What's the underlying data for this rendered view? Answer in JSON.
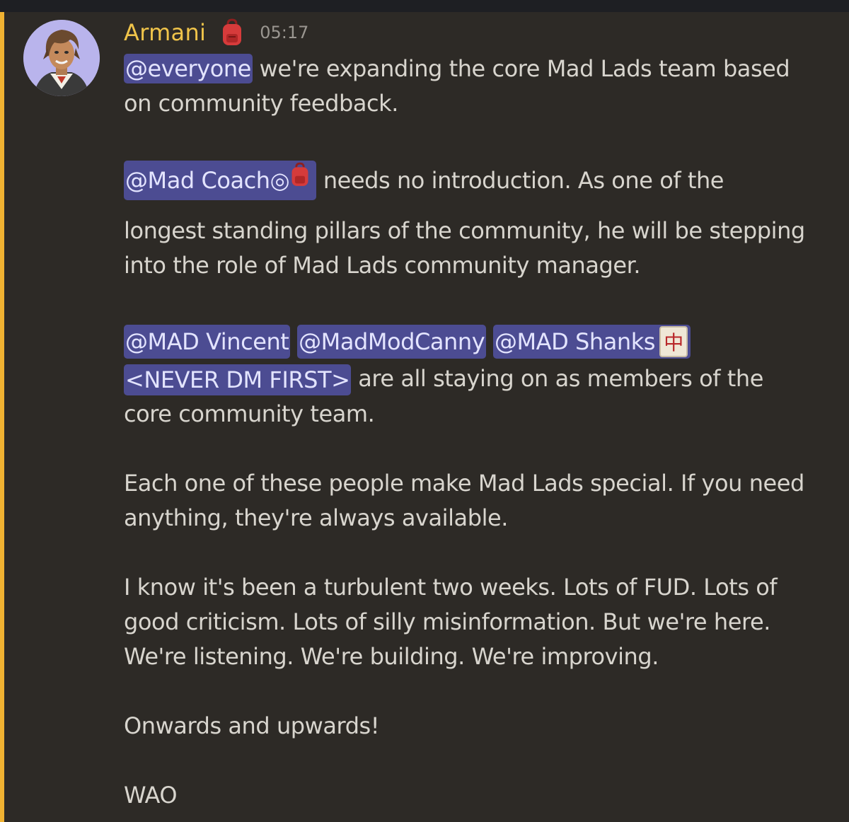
{
  "message": {
    "author": "Armani",
    "author_color": "#f0c44a",
    "role_icon": "red-backpack-icon",
    "timestamp": "05:17",
    "mentions": {
      "everyone": "@everyone",
      "mad_coach": "@Mad Coach",
      "mad_vincent": "@MAD Vincent",
      "madmodcanny": "@MadModCanny",
      "mad_shanks": "@MAD Shanks",
      "never_dm_first": "<NEVER DM FIRST>"
    },
    "text": {
      "p1_line1_rest": " we're expanding the core Mad Lads team based",
      "p1_line2": "on community feedback.",
      "p2_line1_rest": " needs no introduction. As one of the",
      "p2_line2": "longest standing pillars of the community, he will be stepping",
      "p2_line3": "into the role of Mad Lads community manager.",
      "p3_line2_rest": " are all staying on as members of the",
      "p3_line3": "core community team.",
      "p4_line1": "Each one of these people make Mad Lads special. If you need",
      "p4_line2": "anything, they're always available.",
      "p5_line1": "I know it's been a turbulent two weeks. Lots of FUD. Lots of",
      "p5_line2": "good criticism. Lots of silly misinformation. But we're here.",
      "p5_line3": "We're listening. We're building. We're improving.",
      "p6_line1": "Onwards and upwards!",
      "p7_line1": "WAO"
    },
    "mahjong_glyph": "中",
    "ring_glyph": "◎"
  },
  "colors": {
    "background": "#2d2a26",
    "mention_bar": "#f0b232",
    "mention_bg": "#4c4c92",
    "text": "#d8d5ce",
    "timestamp": "#9a9690"
  }
}
